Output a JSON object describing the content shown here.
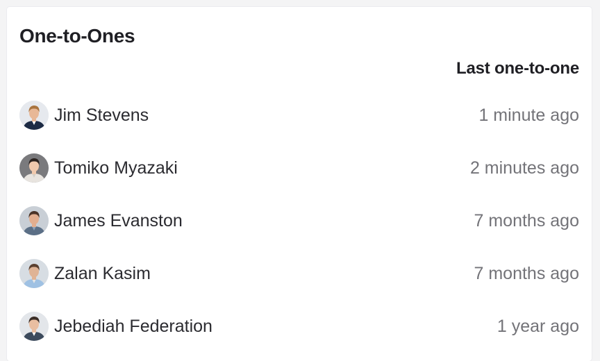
{
  "widget": {
    "title": "One-to-Ones",
    "column_header": "Last one-to-one"
  },
  "people": [
    {
      "name": "Jim Stevens",
      "last": "1 minute ago",
      "avatar": {
        "bg": "#e6e9ee",
        "skin": "#e8b897",
        "hair": "#a9743f",
        "shirt": "#1d2b44",
        "accent": "#ffffff"
      }
    },
    {
      "name": "Tomiko Myazaki",
      "last": "2 minutes ago",
      "avatar": {
        "bg": "#7a7a7d",
        "skin": "#f0c9ad",
        "hair": "#2c2320",
        "shirt": "#e8e4df",
        "accent": "#d6cfc6"
      }
    },
    {
      "name": "James Evanston",
      "last": "7 months ago",
      "avatar": {
        "bg": "#c9cfd6",
        "skin": "#e2ae8f",
        "hair": "#4a3327",
        "shirt": "#5b6f86",
        "accent": "#8ea2b8"
      }
    },
    {
      "name": "Zalan Kasim",
      "last": "7 months ago",
      "avatar": {
        "bg": "#d7dde3",
        "skin": "#dfb395",
        "hair": "#5a4030",
        "shirt": "#9fc1e3",
        "accent": "#e6e6e6"
      }
    },
    {
      "name": "Jebediah Federation",
      "last": "1 year ago",
      "avatar": {
        "bg": "#e3e6ea",
        "skin": "#e9bea1",
        "hair": "#3b2e27",
        "shirt": "#3c4a5c",
        "accent": "#ffffff"
      }
    }
  ]
}
